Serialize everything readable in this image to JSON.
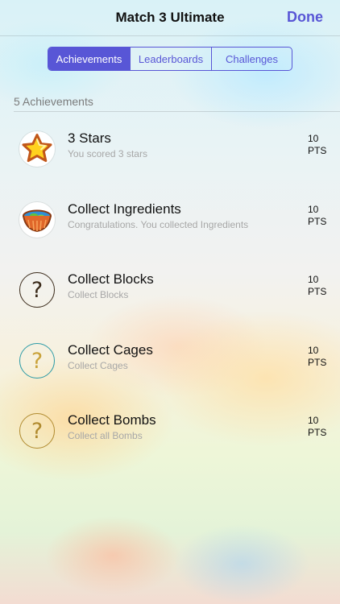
{
  "nav": {
    "title": "Match 3 Ultimate",
    "done_label": "Done"
  },
  "tabs": [
    {
      "label": "Achievements",
      "selected": true
    },
    {
      "label": "Leaderboards",
      "selected": false
    },
    {
      "label": "Challenges",
      "selected": false
    }
  ],
  "section": {
    "count_label": "5 Achievements"
  },
  "achievements": [
    {
      "title": "3 Stars",
      "subtitle": "You scored 3 stars",
      "points": "10",
      "points_unit": "PTS",
      "icon": "star-icon"
    },
    {
      "title": "Collect Ingredients",
      "subtitle": "Congratulations. You collected Ingredients",
      "points": "10",
      "points_unit": "PTS",
      "icon": "ingredients-bowl-icon"
    },
    {
      "title": "Collect Blocks",
      "subtitle": "Collect Blocks",
      "points": "10",
      "points_unit": "PTS",
      "icon": "question-mark-icon",
      "ring_color": "#3a2a1a"
    },
    {
      "title": "Collect Cages",
      "subtitle": "Collect Cages",
      "points": "10",
      "points_unit": "PTS",
      "icon": "question-mark-icon",
      "ring_color": "#2a9aa6"
    },
    {
      "title": "Collect Bombs",
      "subtitle": "Collect all Bombs",
      "points": "10",
      "points_unit": "PTS",
      "icon": "question-mark-icon",
      "ring_color": "#b08a2e"
    }
  ],
  "colors": {
    "accent": "#5856d6"
  }
}
